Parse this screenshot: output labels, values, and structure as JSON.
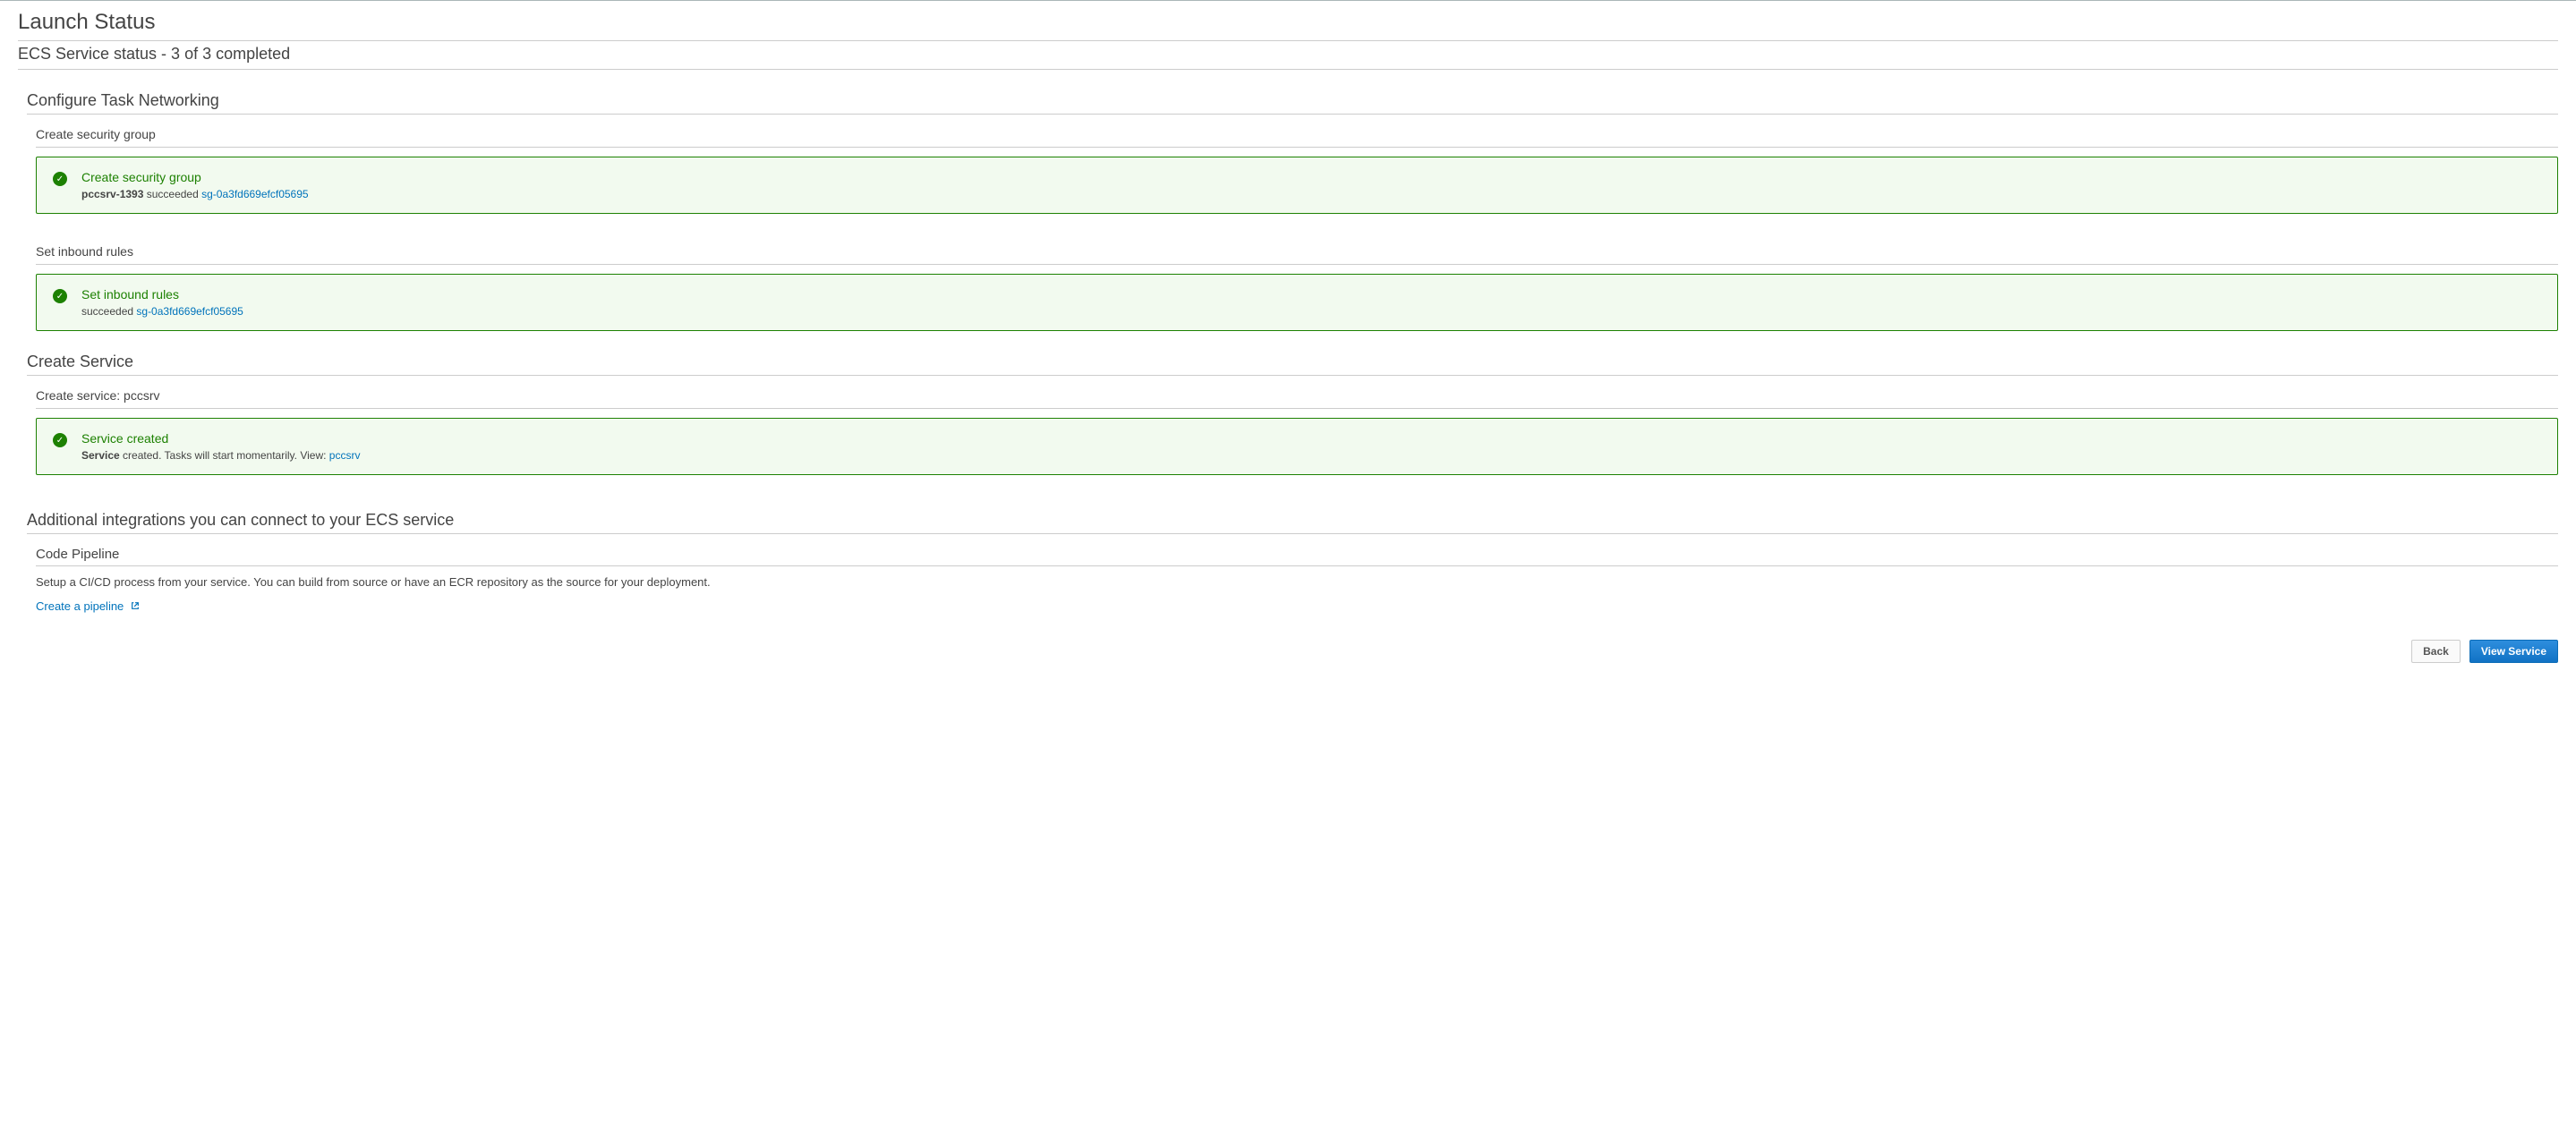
{
  "page_title": "Launch Status",
  "status_line": "ECS Service status - 3 of 3 completed",
  "sections": {
    "configure": {
      "heading": "Configure Task Networking",
      "security_group": {
        "label": "Create security group",
        "box_title": "Create security group",
        "name": "pccsrv-1393",
        "status_word": "succeeded",
        "link": "sg-0a3fd669efcf05695"
      },
      "inbound": {
        "label": "Set inbound rules",
        "box_title": "Set inbound rules",
        "status_word": "succeeded",
        "link": "sg-0a3fd669efcf05695"
      }
    },
    "create_service": {
      "heading": "Create Service",
      "label": "Create service: pccsrv",
      "box_title": "Service created",
      "detail_bold": "Service",
      "detail_rest": " created. Tasks will start momentarily. View: ",
      "link": "pccsrv"
    },
    "integrations": {
      "heading": "Additional integrations you can connect to your ECS service",
      "pipeline_label": "Code Pipeline",
      "pipeline_desc": "Setup a CI/CD process from your service. You can build from source or have an ECR repository as the source for your deployment.",
      "pipeline_link": "Create a pipeline"
    }
  },
  "footer": {
    "back": "Back",
    "view": "View Service"
  }
}
